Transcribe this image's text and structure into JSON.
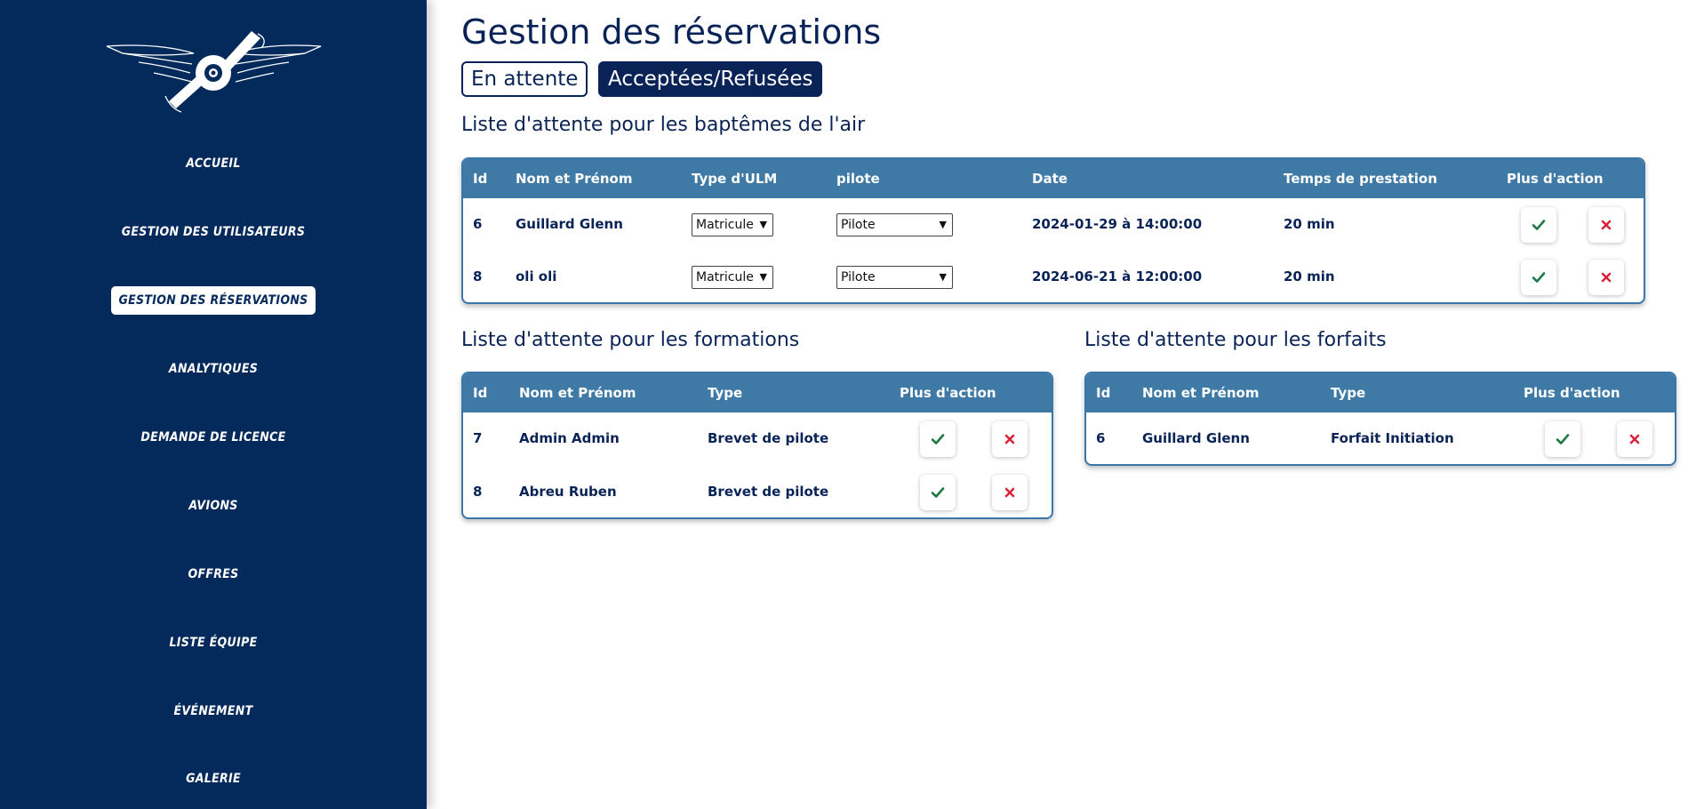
{
  "sidebar": {
    "items": [
      {
        "label": "ACCUEIL",
        "active": false
      },
      {
        "label": "GESTION DES UTILISATEURS",
        "active": false
      },
      {
        "label": "GESTION DES RÉSERVATIONS",
        "active": true
      },
      {
        "label": "ANALYTIQUES",
        "active": false
      },
      {
        "label": "DEMANDE DE LICENCE",
        "active": false
      },
      {
        "label": "AVIONS",
        "active": false
      },
      {
        "label": "OFFRES",
        "active": false
      },
      {
        "label": "LISTE ÉQUIPE",
        "active": false
      },
      {
        "label": "ÉVÉNEMENT",
        "active": false
      },
      {
        "label": "GALERIE",
        "active": false
      }
    ]
  },
  "main": {
    "title": "Gestion des réservations",
    "tabs": [
      {
        "label": "En attente"
      },
      {
        "label": "Acceptées/Refusées"
      }
    ]
  },
  "baptemes": {
    "title": "Liste d'attente pour les baptêmes de l'air",
    "headers": [
      "Id",
      "Nom et Prénom",
      "Type d'ULM",
      "pilote",
      "Date",
      "Temps de prestation",
      "Plus d'action"
    ],
    "rows": [
      {
        "id": "6",
        "name": "Guillard Glenn",
        "ulm": "Matricule",
        "pilote": "Pilote",
        "date": "2024-01-29 à 14:00:00",
        "duration": "20 min"
      },
      {
        "id": "8",
        "name": "oli oli",
        "ulm": "Matricule",
        "pilote": "Pilote",
        "date": "2024-06-21 à 12:00:00",
        "duration": "20 min"
      }
    ]
  },
  "formations": {
    "title": "Liste d'attente pour les formations",
    "headers": [
      "Id",
      "Nom et Prénom",
      "Type",
      "Plus d'action"
    ],
    "rows": [
      {
        "id": "7",
        "name": "Admin Admin",
        "type": "Brevet de pilote"
      },
      {
        "id": "8",
        "name": "Abreu Ruben",
        "type": "Brevet de pilote"
      }
    ]
  },
  "forfaits": {
    "title": "Liste d'attente pour les forfaits",
    "headers": [
      "Id",
      "Nom et Prénom",
      "Type",
      "Plus d'action"
    ],
    "rows": [
      {
        "id": "6",
        "name": "Guillard Glenn",
        "type": "Forfait Initiation"
      }
    ]
  },
  "icons": {
    "accept": "check-icon",
    "reject": "close-icon",
    "dropdown": "chevron-down-icon",
    "logo": "winged-propeller-logo"
  },
  "colors": {
    "sidebar": "#042a5c",
    "header": "#3f7aa7",
    "accept": "#1e7a45",
    "reject": "#d9233a"
  }
}
